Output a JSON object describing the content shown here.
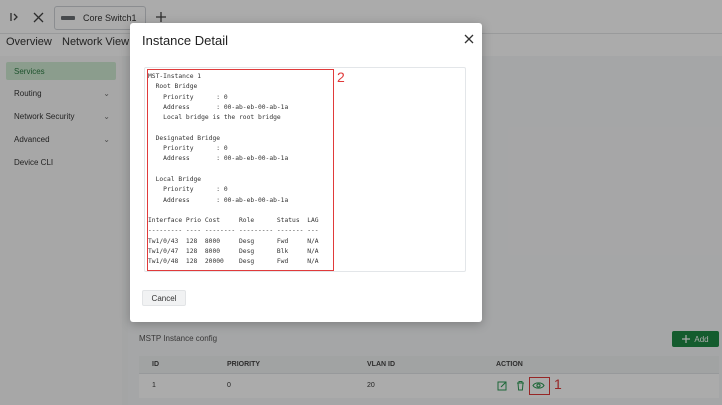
{
  "topbar": {
    "tab_label": "Core Switch1"
  },
  "nav_tabs": [
    "Overview",
    "Network View"
  ],
  "sidebar": {
    "items": [
      {
        "label": "Services",
        "active": true
      },
      {
        "label": "Routing"
      },
      {
        "label": "Network Security"
      },
      {
        "label": "Advanced"
      },
      {
        "label": "Device CLI"
      }
    ]
  },
  "section": {
    "title": "MSTP Instance config",
    "add_label": "Add"
  },
  "table": {
    "headers": [
      "ID",
      "PRIORITY",
      "VLAN ID",
      "ACTION"
    ],
    "rows": [
      {
        "id": "1",
        "priority": "0",
        "vlan_id": "20"
      }
    ]
  },
  "annotations": {
    "marker1": "1",
    "marker2": "2",
    "highlight_color": "#e03a3a"
  },
  "modal": {
    "title": "Instance Detail",
    "cancel_label": "Cancel",
    "code_lines": [
      "MST-Instance 1",
      "  Root Bridge",
      "    Priority      : 0",
      "    Address       : 00-ab-eb-00-ab-1a",
      "    Local bridge is the root bridge",
      "",
      "  Designated Bridge",
      "    Priority      : 0",
      "    Address       : 00-ab-eb-00-ab-1a",
      "",
      "  Local Bridge",
      "    Priority      : 0",
      "    Address       : 00-ab-eb-00-ab-1a",
      "",
      "Interface Prio Cost     Role      Status  LAG",
      "--------- ---- -------- --------- ------- ---",
      "Tw1/0/43  128  8000     Desg      Fwd     N/A",
      "Tw1/0/47  128  8000     Desg      Blk     N/A",
      "Tw1/0/48  128  20000    Desg      Fwd     N/A"
    ]
  },
  "colors": {
    "accent": "#1f8a45",
    "active_bg": "#cfead3"
  }
}
